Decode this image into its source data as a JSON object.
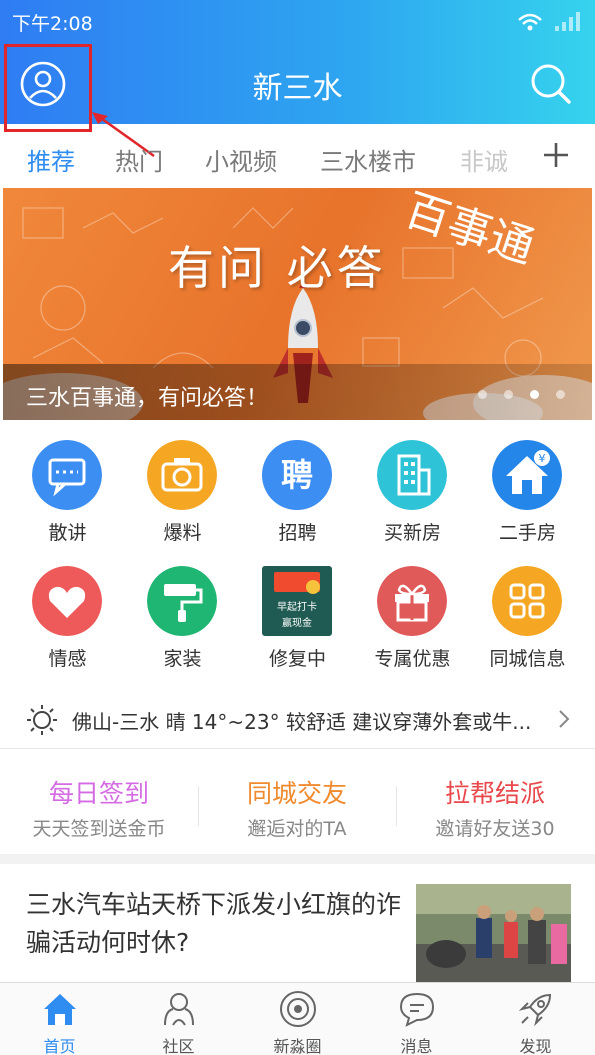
{
  "status_bar": {
    "time": "下午2:08"
  },
  "header": {
    "title": "新三水"
  },
  "tabs": [
    {
      "label": "推荐"
    },
    {
      "label": "热门"
    },
    {
      "label": "小视频"
    },
    {
      "label": "三水楼市"
    },
    {
      "label": "非诚"
    }
  ],
  "banner": {
    "headline": "有问  必答",
    "tag": "百事通",
    "caption": "三水百事通，有问必答！",
    "page_count": 4,
    "active_page": 3
  },
  "grid": [
    {
      "label": "散讲",
      "icon": "chat-bubble-icon",
      "color": "#3d8ef2"
    },
    {
      "label": "爆料",
      "icon": "camera-icon",
      "color": "#f5a623"
    },
    {
      "label": "招聘",
      "icon": "recruit-icon",
      "glyph": "聘",
      "color": "#3d8ef2"
    },
    {
      "label": "买新房",
      "icon": "building-icon",
      "color": "#2ec3d6"
    },
    {
      "label": "二手房",
      "icon": "house-icon",
      "color": "#2486e8"
    },
    {
      "label": "情感",
      "icon": "heart-icon",
      "color": "#ee5a5a"
    },
    {
      "label": "家装",
      "icon": "paint-roller-icon",
      "color": "#1fb573"
    },
    {
      "label": "修复中",
      "icon": "checkin-card-icon",
      "card_line1": "早起打卡",
      "card_line2": "赢现金",
      "color": "#1f5b52"
    },
    {
      "label": "专属优惠",
      "icon": "gift-icon",
      "color": "#e05a5a"
    },
    {
      "label": "同城信息",
      "icon": "grid-apps-icon",
      "color": "#f5a623"
    }
  ],
  "weather": {
    "text": "佛山-三水 晴 14°~23° 较舒适 建议穿薄外套或牛..."
  },
  "features": [
    {
      "title": "每日签到",
      "subtitle": "天天签到送金币",
      "color": "#d56be3"
    },
    {
      "title": "同城交友",
      "subtitle": "邂逅对的TA",
      "color": "#f08a2e"
    },
    {
      "title": "拉帮结派",
      "subtitle": "邀请好友送30",
      "color": "#e9484d"
    }
  ],
  "news": {
    "title": "三水汽车站天桥下派发小红旗的诈骗活动何时休?"
  },
  "bottom_nav": [
    {
      "label": "首页",
      "icon": "home-icon"
    },
    {
      "label": "社区",
      "icon": "community-icon"
    },
    {
      "label": "新淼圈",
      "icon": "circle-icon"
    },
    {
      "label": "消息",
      "icon": "message-icon"
    },
    {
      "label": "发现",
      "icon": "rocket-icon"
    }
  ],
  "colors": {
    "accent": "#2f8cf0",
    "annotation": "#e0262a"
  }
}
